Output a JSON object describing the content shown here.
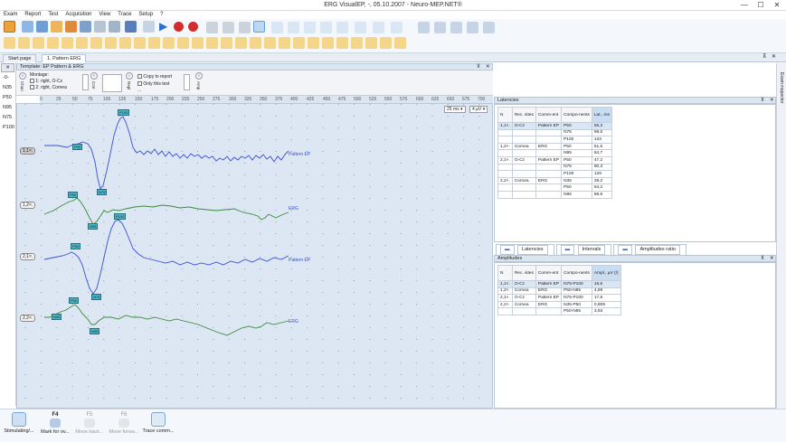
{
  "window": {
    "title": "ERG VisualEP, -, 05.10.2007 - Neuro-MEP.NET®",
    "minimize": "—",
    "maximize": "☐",
    "close": "✕"
  },
  "menu": [
    "Exam",
    "Report",
    "Test",
    "Acquisition",
    "View",
    "Trace",
    "Setup",
    "?"
  ],
  "tabs": {
    "start": "Start page",
    "active": "1. Pattern ERG"
  },
  "left_list": [
    "-0-",
    "N35",
    "P50",
    "N95",
    "N75",
    "P100"
  ],
  "template": {
    "header": "Template: EP Pattern & ERG",
    "montage_label": "Montage:",
    "montage_1": "1: right, O-Cz",
    "montage_2": "2: right, Cornea",
    "chan_label": "Chan",
    "corr_label": "Corr",
    "repl_label": "Repl",
    "amp_label": "Amp",
    "copy_to_report": "Copy to report",
    "only_this_test": "Only this test",
    "dots": "..."
  },
  "ruler": {
    "ticks": [
      "0",
      "25",
      "50",
      "75",
      "100",
      "125",
      "150",
      "175",
      "200",
      "225",
      "250",
      "275",
      "300",
      "325",
      "350",
      "375",
      "400",
      "425",
      "450",
      "475",
      "500",
      "525",
      "550",
      "575",
      "600",
      "625",
      "650",
      "675",
      "700"
    ],
    "timebase": "25 ms",
    "gain": "4 µV"
  },
  "traces": [
    {
      "id": "1,1×.",
      "label": "Pattern EP",
      "color": "#3a4fd0",
      "markers": [
        "P50",
        "N75",
        "P100"
      ]
    },
    {
      "id": "1,2×.",
      "label": "ERG",
      "color": "#3a8a3a",
      "markers": [
        "P50",
        "N95"
      ]
    },
    {
      "id": "2,1×.",
      "label": "Pattern EP",
      "color": "#3a4fd0",
      "markers": [
        "P50",
        "N75",
        "P100"
      ]
    },
    {
      "id": "2,2×.",
      "label": "ERG",
      "color": "#3a8a3a",
      "markers": [
        "N35",
        "P50",
        "N95"
      ]
    }
  ],
  "latencies": {
    "title": "Latencies",
    "headers": [
      "N",
      "Rec. sites",
      "Comm-ent",
      "Compo-nents",
      "Lat., ms"
    ],
    "rows": [
      [
        "1,1×.",
        "O-Cz",
        "Pattern EP",
        "P50",
        "56,3"
      ],
      [
        "",
        "",
        "",
        "N75",
        "98,6"
      ],
      [
        "",
        "",
        "",
        "P100",
        "133"
      ],
      [
        "1,2×.",
        "Cornea",
        "ERG",
        "P50",
        "51,6"
      ],
      [
        "",
        "",
        "",
        "N95",
        "84,7"
      ],
      [
        "2,1×.",
        "O-Cz",
        "Pattern EP",
        "P50",
        "47,2"
      ],
      [
        "",
        "",
        "",
        "N75",
        "90,3"
      ],
      [
        "",
        "",
        "",
        "P100",
        "129"
      ],
      [
        "2,2×.",
        "Cornea",
        "ERG",
        "N35",
        "28,2"
      ],
      [
        "",
        "",
        "",
        "P50",
        "54,2"
      ],
      [
        "",
        "",
        "",
        "N95",
        "88,9"
      ]
    ]
  },
  "panel_tabs": [
    "Latencies",
    "Intervals",
    "Amplitudes ratio"
  ],
  "amplitudes": {
    "title": "Amplitudes",
    "headers": [
      "N",
      "Rec. sites",
      "Comm-ent",
      "Compo-nents",
      "Ampl., µV (/)"
    ],
    "rows": [
      [
        "1,1×.",
        "O-Cz",
        "Pattern EP",
        "N75-P100",
        "16,6"
      ],
      [
        "1,2×.",
        "Cornea",
        "ERG",
        "P50-N95",
        "4,59"
      ],
      [
        "2,1×.",
        "O-Cz",
        "Pattern EP",
        "N75-P100",
        "17,6"
      ],
      [
        "2,2×.",
        "Cornea",
        "ERG",
        "N35-P50",
        "0,909"
      ],
      [
        "",
        "",
        "",
        "P50-N95",
        "3,93"
      ]
    ]
  },
  "inspector": "Exam inspector",
  "bottom": [
    {
      "label": "Stimulating/...",
      "key": ""
    },
    {
      "label": "Mark for ov...",
      "key": "F4"
    },
    {
      "label": "Move back...",
      "key": "F5"
    },
    {
      "label": "Move forwa...",
      "key": "F6"
    },
    {
      "label": "Trace comm...",
      "key": ""
    }
  ]
}
